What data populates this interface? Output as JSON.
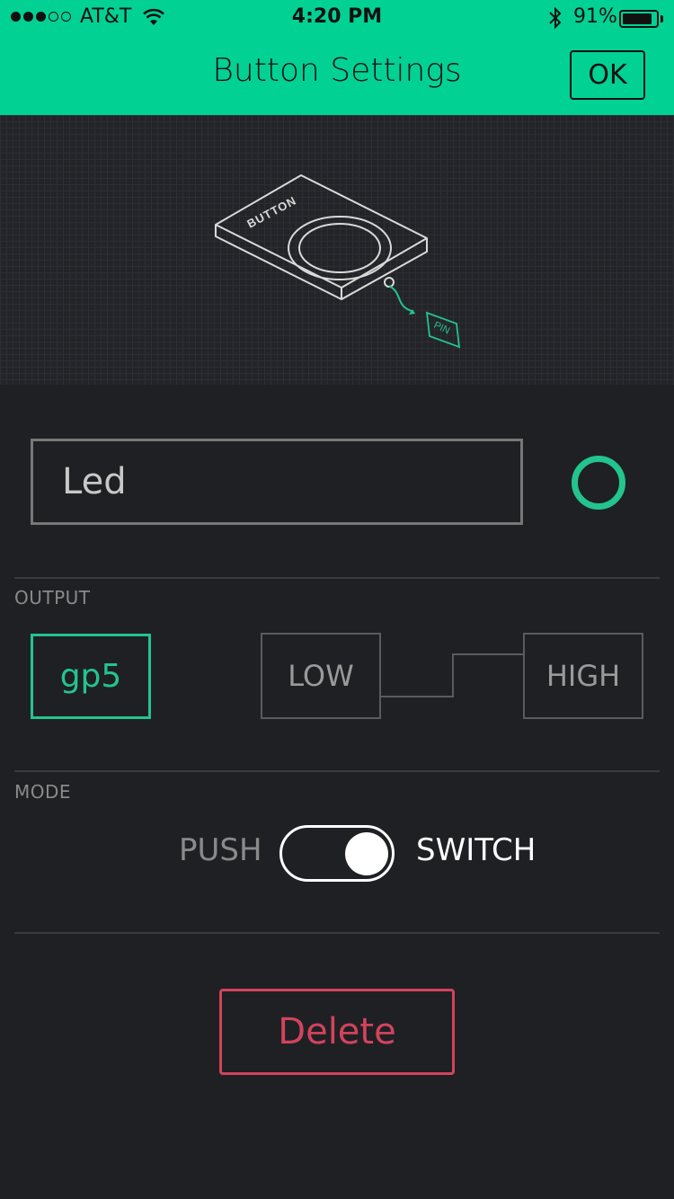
{
  "status_bar": {
    "carrier": "AT&T",
    "time": "4:20 PM",
    "battery": "91%",
    "battery_level": 0.91,
    "signal_bars_filled": 3,
    "signal_bars_total": 5
  },
  "header": {
    "title": "Button Settings",
    "ok_label": "OK"
  },
  "preview": {
    "widget_label": "BUTTON",
    "pin_label": "PIN"
  },
  "name_field": {
    "value": "Led"
  },
  "output": {
    "section_label": "OUTPUT",
    "pin": "gp5",
    "low_label": "LOW",
    "high_label": "HIGH"
  },
  "mode": {
    "section_label": "MODE",
    "push_label": "PUSH",
    "switch_label": "SWITCH",
    "selected": "SWITCH"
  },
  "actions": {
    "delete_label": "Delete"
  },
  "colors": {
    "header_bg": "#02d194",
    "accent": "#23c48e",
    "danger": "#d3435c",
    "background": "#1f2024"
  },
  "icons": [
    "wifi-icon",
    "bluetooth-icon",
    "battery-icon"
  ]
}
